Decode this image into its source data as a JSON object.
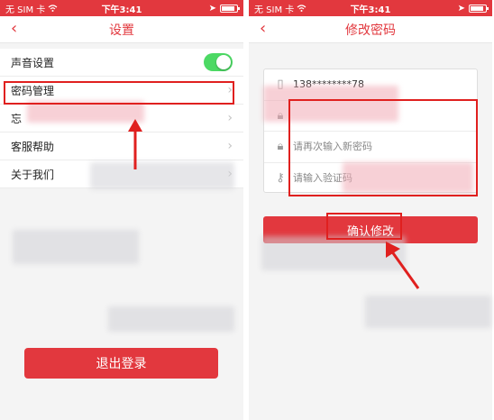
{
  "left_screen": {
    "status": {
      "carrier": "无 SIM 卡",
      "time": "下午3:41"
    },
    "nav": {
      "title": "设置",
      "back_glyph": "‹"
    },
    "settings": {
      "sound": "声音设置",
      "sound_enabled": true,
      "password": "密码管理",
      "partial": "忘",
      "help": "客服帮助",
      "about": "关于我们"
    },
    "logout_label": "退出登录"
  },
  "right_screen": {
    "status": {
      "carrier": "无 SIM 卡",
      "time": "下午3:41"
    },
    "nav": {
      "title": "修改密码",
      "back_glyph": "‹"
    },
    "phone_value": "138********78",
    "new_password_placeholder": "",
    "repeat_password_placeholder": "请再次输入新密码",
    "code_placeholder": "请输入验证码",
    "confirm_label": "确认修改"
  },
  "colors": {
    "accent": "#e2383e",
    "toggle_on": "#4cd964",
    "highlight": "#e0201f"
  },
  "icons": {
    "back": "chevron-left-icon",
    "row": "chevron-right-icon",
    "lock": "lock-icon",
    "key": "key-icon",
    "phone": "phone-icon"
  }
}
